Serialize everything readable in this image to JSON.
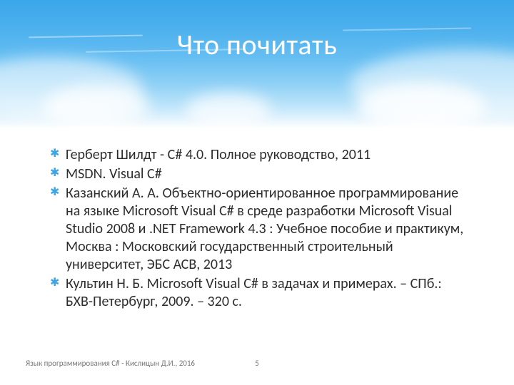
{
  "title": "Что почитать",
  "bullets": [
    "Герберт Шилдт - С# 4.0. Полное руководство, 2011",
    "MSDN. Visual C#",
    "Казанский А. А. Объектно-ориентированное программирование на языке Microsoft Visual C# в среде разработки Microsoft Visual Studio 2008 и .NET Framework 4.3 : Учебное пособие и практикум, Москва : Московский государственный строительный университет, ЭБС АСВ, 2013",
    "Культин Н. Б. Microsoft Visual C# в задачах и примерах. – СПб.: БХВ-Петербург, 2009. – 320 с."
  ],
  "footer": "Язык программирования С# - Кислицын Д.И., 2016",
  "page_number": "5",
  "colors": {
    "accent": "#3aa6ea",
    "title_text": "#ffffff",
    "body_text": "#2d2d2d",
    "muted": "#777777"
  }
}
